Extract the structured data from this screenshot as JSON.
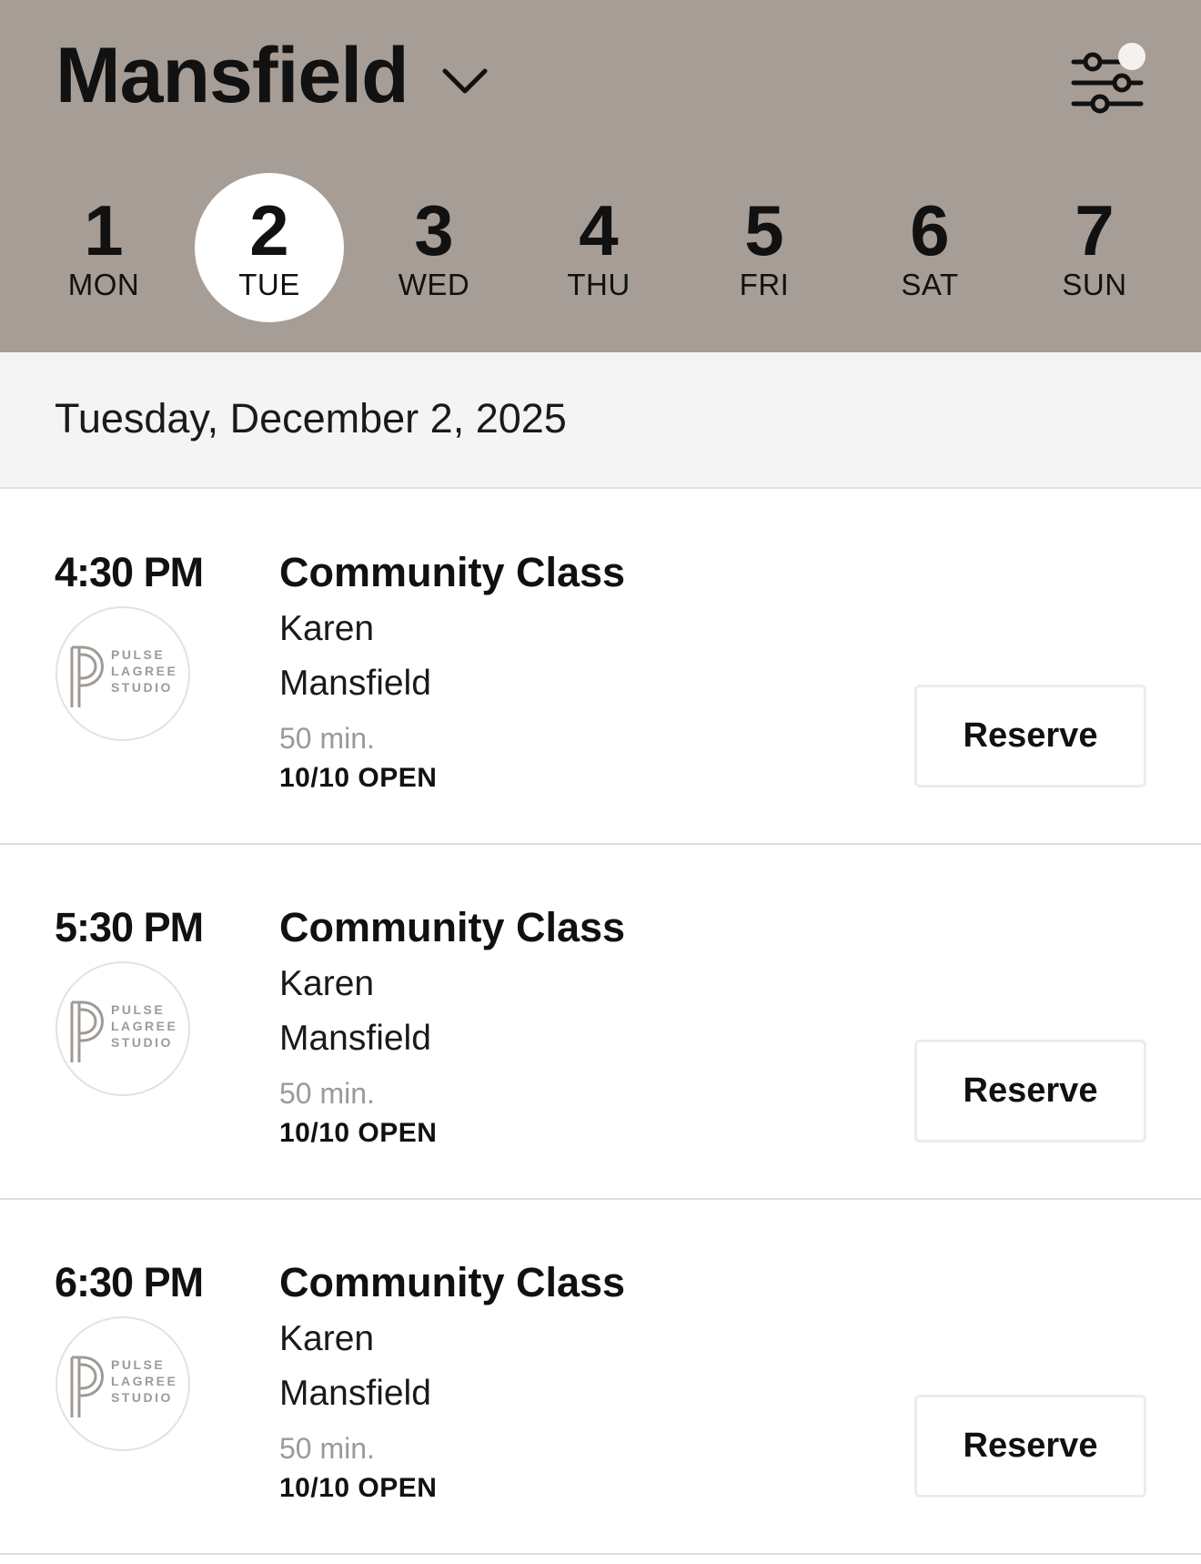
{
  "header": {
    "location": "Mansfield",
    "location_icon": "chevron-down-icon",
    "filter_icon": "sliders-icon",
    "background_color": "#a69d96"
  },
  "days": [
    {
      "num": "1",
      "label": "MON",
      "selected": false
    },
    {
      "num": "2",
      "label": "TUE",
      "selected": true
    },
    {
      "num": "3",
      "label": "WED",
      "selected": false
    },
    {
      "num": "4",
      "label": "THU",
      "selected": false
    },
    {
      "num": "5",
      "label": "FRI",
      "selected": false
    },
    {
      "num": "6",
      "label": "SAT",
      "selected": false
    },
    {
      "num": "7",
      "label": "SUN",
      "selected": false
    }
  ],
  "date_heading": "Tuesday, December 2, 2025",
  "classes": [
    {
      "time": "4:30 PM",
      "title": "Community Class",
      "instructor": "Karen",
      "studio": "Mansfield",
      "duration": "50 min.",
      "availability": "10/10 OPEN",
      "button": "Reserve"
    },
    {
      "time": "5:30 PM",
      "title": "Community Class",
      "instructor": "Karen",
      "studio": "Mansfield",
      "duration": "50 min.",
      "availability": "10/10 OPEN",
      "button": "Reserve"
    },
    {
      "time": "6:30 PM",
      "title": "Community Class",
      "instructor": "Karen",
      "studio": "Mansfield",
      "duration": "50 min.",
      "availability": "10/10 OPEN",
      "button": "Reserve"
    }
  ],
  "logo": {
    "line1": "PULSE",
    "line2": "LAGREE",
    "line3": "STUDIO"
  }
}
